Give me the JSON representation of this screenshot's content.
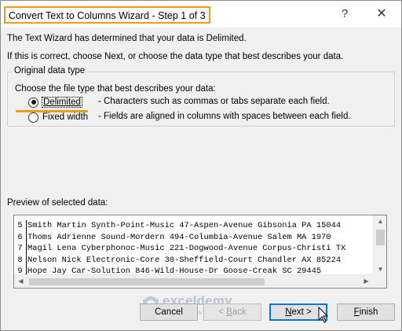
{
  "window": {
    "title": "Convert Text to Columns Wizard - Step 1 of 3",
    "help_glyph": "?",
    "close_glyph": "✕"
  },
  "intro": {
    "line1": "The Text Wizard has determined that your data is Delimited.",
    "line2": "If this is correct, choose Next, or choose the data type that best describes your data."
  },
  "original_data_type": {
    "legend": "Original data type",
    "prompt": "Choose the file type that best describes your data:",
    "options": [
      {
        "label": "Delimited",
        "description": "- Characters such as commas or tabs separate each field.",
        "selected": true
      },
      {
        "label": "Fixed width",
        "description": "- Fields are aligned in columns with spaces between each field.",
        "selected": false
      }
    ]
  },
  "preview": {
    "label": "Preview of selected data:",
    "rows": [
      {
        "num": "5",
        "text": "Smith Martin Synth-Point-Music 47-Aspen-Avenue Gibsonia PA 15044"
      },
      {
        "num": "6",
        "text": "Thoms Adrienne Sound-Mordern 494-Columbia-Avenue Salem MA 1970"
      },
      {
        "num": "7",
        "text": "Magil Lena Cyberphonoc-Music 221-Dogwood-Avenue Corpus-Christi TX"
      },
      {
        "num": "8",
        "text": "Nelson Nick Electronic-Core 30-Sheffield-Court Chandler AX 85224"
      },
      {
        "num": "9",
        "text": "Hope Jay Car-Solution 846-Wild-House-Dr Goose-Creak SC 29445"
      }
    ]
  },
  "buttons": {
    "cancel": "Cancel",
    "back_pre": "< ",
    "back_key": "B",
    "back_post": "ack",
    "next_pre": "",
    "next_key": "N",
    "next_post": "ext >",
    "finish_key": "F",
    "finish_post": "inish"
  },
  "watermark": {
    "name": "exceldemy",
    "tagline": "EXCEL · DATA · BI"
  },
  "colors": {
    "highlight_orange": "#f39c12",
    "default_button_border": "#0078d7"
  }
}
